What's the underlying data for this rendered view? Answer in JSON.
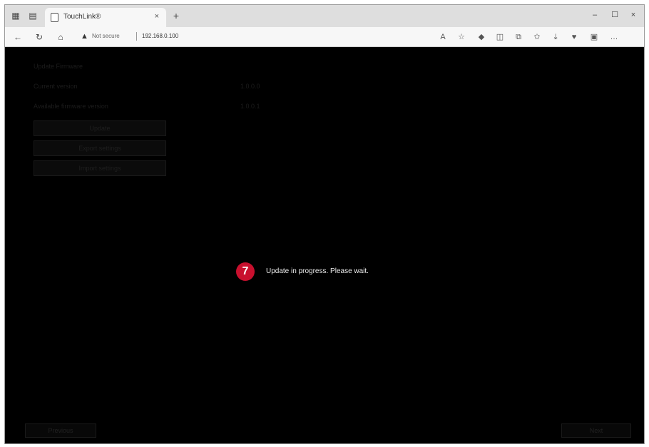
{
  "browser": {
    "tab": {
      "title": "TouchLink®",
      "close_glyph": "×"
    },
    "new_tab_glyph": "+",
    "tabstrip_icons": [
      "workspaces-icon",
      "tab-actions-icon"
    ],
    "window_controls": {
      "minimize": "–",
      "restore": "☐",
      "close": "×"
    },
    "nav": {
      "back": "←",
      "refresh": "↻",
      "home": "⌂"
    },
    "address": {
      "security_label": "Not secure",
      "url": "192.168.0.100"
    },
    "toolbar_icons": [
      {
        "name": "read-aloud-icon",
        "glyph": "A"
      },
      {
        "name": "favorite-star-icon",
        "glyph": "☆"
      },
      {
        "name": "extension-icon",
        "glyph": "◆"
      },
      {
        "name": "split-screen-icon",
        "glyph": "◫"
      },
      {
        "name": "collections-icon",
        "glyph": "⧉"
      },
      {
        "name": "favorites-icon",
        "glyph": "✩"
      },
      {
        "name": "downloads-icon",
        "glyph": "⤓"
      },
      {
        "name": "browser-essentials-icon",
        "glyph": "♥"
      },
      {
        "name": "copilot-icon",
        "glyph": "▣"
      },
      {
        "name": "more-icon",
        "glyph": "…"
      }
    ]
  },
  "page": {
    "header_text": "Update Firmware",
    "rows": [
      {
        "label": "Current version",
        "value": "1.0.0.0"
      },
      {
        "label": "Available firmware version",
        "value": "1.0.0.1"
      }
    ],
    "buttons": [
      "Update",
      "Export settings",
      "Import settings"
    ],
    "step_number": "7",
    "progress_message": "Update in progress. Please wait.",
    "back_label": "Previous",
    "next_label": "Next",
    "colors": {
      "badge": "#c8102e",
      "background": "#000000"
    }
  }
}
